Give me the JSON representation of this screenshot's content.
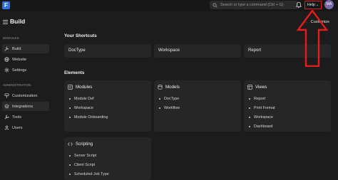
{
  "app": {
    "logo_letter": "F",
    "page_title": "Build"
  },
  "topbar": {
    "search_placeholder": "Search or type a command (Ctrl + G)",
    "help_label": "Help",
    "avatar_initials": "MA"
  },
  "header": {
    "customize_label": "Customize"
  },
  "sidebar": {
    "sections": [
      {
        "title": "MODULES",
        "items": [
          {
            "label": "Build",
            "icon": "tools-icon",
            "active": true
          },
          {
            "label": "Website",
            "icon": "globe-icon",
            "active": false
          },
          {
            "label": "Settings",
            "icon": "gear-icon",
            "active": false
          }
        ]
      },
      {
        "title": "ADMINISTRATION",
        "items": [
          {
            "label": "Customization",
            "icon": "paint-icon",
            "active": false
          },
          {
            "label": "Integrations",
            "icon": "integrations-icon",
            "active": true
          },
          {
            "label": "Tools",
            "icon": "wrench-icon",
            "active": false
          },
          {
            "label": "Users",
            "icon": "user-icon",
            "active": false
          }
        ]
      }
    ]
  },
  "shortcuts": {
    "title": "Your Shortcuts",
    "items": [
      "DocType",
      "Workspace",
      "Report"
    ]
  },
  "elements": {
    "title": "Elements",
    "cards": [
      {
        "title": "Modules",
        "links": [
          "Module Def",
          "Workspace",
          "Module Onboarding"
        ]
      },
      {
        "title": "Models",
        "links": [
          "DocType",
          "Workflow"
        ]
      },
      {
        "title": "Views",
        "links": [
          "Report",
          "Print Format",
          "Workspace",
          "Dashboard"
        ]
      },
      {
        "title": "Scripting",
        "links": [
          "Server Script",
          "Client Script",
          "Scheduled Job Type"
        ]
      }
    ]
  },
  "colors": {
    "highlight": "#e51c1c",
    "background": "#1c1c1c",
    "card": "#262626",
    "accent": "#2f6fe0"
  }
}
